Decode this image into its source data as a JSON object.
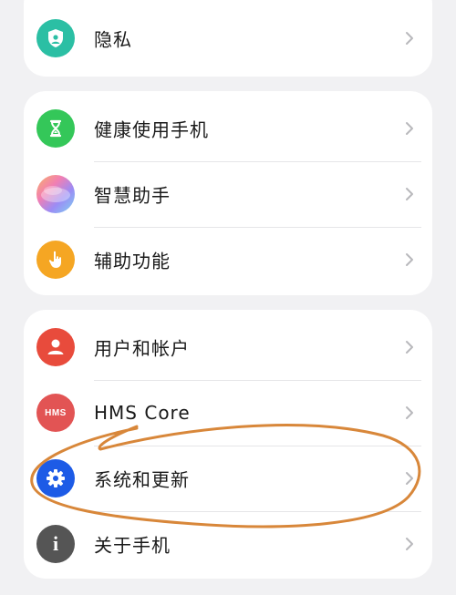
{
  "groups": [
    {
      "items": [
        {
          "label": "隐私",
          "icon": "privacy-shield-icon",
          "color": "#2bbfa4"
        }
      ]
    },
    {
      "items": [
        {
          "label": "健康使用手机",
          "icon": "hourglass-icon",
          "color": "#34c759"
        },
        {
          "label": "智慧助手",
          "icon": "smart-assistant-icon",
          "color": "#b88cf0"
        },
        {
          "label": "辅助功能",
          "icon": "hand-pointer-icon",
          "color": "#f5a623"
        }
      ]
    },
    {
      "items": [
        {
          "label": "用户和帐户",
          "icon": "user-icon",
          "color": "#e84b3c"
        },
        {
          "label": "HMS Core",
          "icon": "hms-icon",
          "color": "#e25454",
          "badge": "HMS"
        },
        {
          "label": "系统和更新",
          "icon": "gear-icon",
          "color": "#1d5be6"
        },
        {
          "label": "关于手机",
          "icon": "info-icon",
          "color": "#555555",
          "badge": "i"
        }
      ]
    }
  ],
  "annotation": {
    "color": "#d8873a"
  }
}
